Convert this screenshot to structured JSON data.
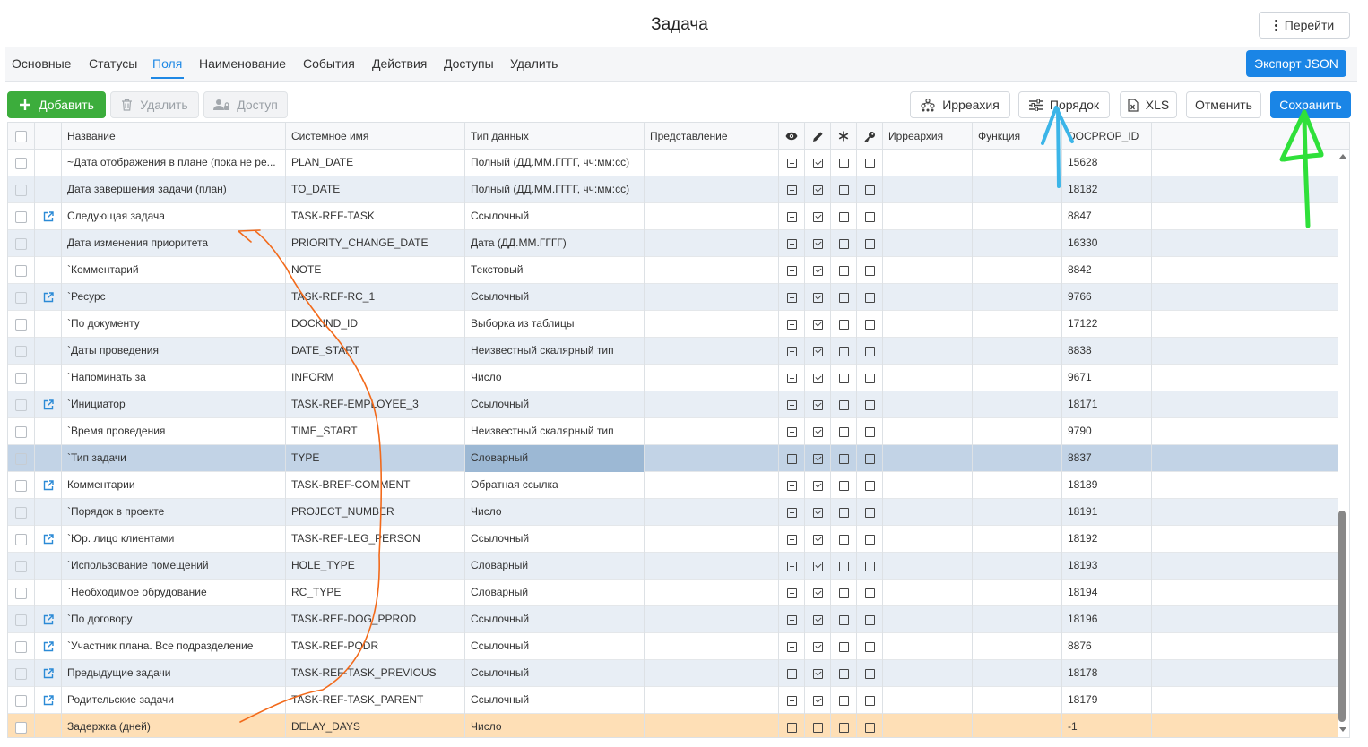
{
  "header": {
    "title": "Задача",
    "goto_label": "Перейти"
  },
  "tabs": [
    {
      "label": "Основные",
      "active": false
    },
    {
      "label": "Статусы",
      "active": false
    },
    {
      "label": "Поля",
      "active": true
    },
    {
      "label": "Наименование",
      "active": false
    },
    {
      "label": "События",
      "active": false
    },
    {
      "label": "Действия",
      "active": false
    },
    {
      "label": "Доступы",
      "active": false
    },
    {
      "label": "Удалить",
      "active": false
    }
  ],
  "export_label": "Экспорт JSON",
  "toolbar": {
    "add_label": "Добавить",
    "delete_label": "Удалить",
    "access_label": "Доступ",
    "hierarchy_label": "Ирреахия",
    "order_label": "Порядок",
    "xls_label": "XLS",
    "cancel_label": "Отменить",
    "save_label": "Сохранить"
  },
  "columns": {
    "name": "Название",
    "sysname": "Системное имя",
    "datatype": "Тип данных",
    "view": "Представление",
    "hierarchy": "Иррearхия",
    "function": "Функция",
    "docprop": "DOCPROP_ID"
  },
  "rows": [
    {
      "link": false,
      "name": "~Дата отображения в плане (пока не ре...",
      "sys": "PLAN_DATE",
      "type": "Полный (ДД.ММ.ГГГГ, чч:мм:сс)",
      "id": "15628",
      "flags": [
        "minus",
        "check",
        "empty",
        "empty"
      ]
    },
    {
      "link": false,
      "name": "Дата завершения задачи (план)",
      "sys": "TO_DATE",
      "type": "Полный (ДД.ММ.ГГГГ, чч:мм:сс)",
      "id": "18182",
      "flags": [
        "minus",
        "check",
        "empty",
        "empty"
      ]
    },
    {
      "link": true,
      "name": "Следующая задача",
      "sys": "TASK-REF-TASK",
      "type": "Ссылочный",
      "id": "8847",
      "flags": [
        "minus",
        "check",
        "empty",
        "empty"
      ]
    },
    {
      "link": false,
      "name": "Дата изменения приоритета",
      "sys": "PRIORITY_CHANGE_DATE",
      "type": "Дата (ДД.ММ.ГГГГ)",
      "id": "16330",
      "flags": [
        "minus",
        "check",
        "empty",
        "empty"
      ]
    },
    {
      "link": false,
      "name": "`Комментарий",
      "sys": "NOTE",
      "type": "Текстовый",
      "id": "8842",
      "flags": [
        "minus",
        "check",
        "empty",
        "empty"
      ]
    },
    {
      "link": true,
      "name": "`Ресурс",
      "sys": "TASK-REF-RC_1",
      "type": "Ссылочный",
      "id": "9766",
      "flags": [
        "minus",
        "check",
        "empty",
        "empty"
      ]
    },
    {
      "link": false,
      "name": "`По документу",
      "sys": "DOCKIND_ID",
      "type": "Выборка из таблицы",
      "id": "17122",
      "flags": [
        "minus",
        "check",
        "empty",
        "empty"
      ]
    },
    {
      "link": false,
      "name": "`Даты проведения",
      "sys": "DATE_START",
      "type": "Неизвестный скалярный тип",
      "id": "8838",
      "flags": [
        "minus",
        "check",
        "empty",
        "empty"
      ]
    },
    {
      "link": false,
      "name": "`Напоминать за",
      "sys": "INFORM",
      "type": "Число",
      "id": "9671",
      "flags": [
        "minus",
        "check",
        "empty",
        "empty"
      ]
    },
    {
      "link": true,
      "name": "`Инициатор",
      "sys": "TASK-REF-EMPLOYEE_3",
      "type": "Ссылочный",
      "id": "18171",
      "flags": [
        "minus",
        "check",
        "empty",
        "empty"
      ]
    },
    {
      "link": false,
      "name": "`Время проведения",
      "sys": "TIME_START",
      "type": "Неизвестный скалярный тип",
      "id": "9790",
      "flags": [
        "minus",
        "check",
        "empty",
        "empty"
      ]
    },
    {
      "link": false,
      "name": "`Тип задачи",
      "sys": "TYPE",
      "type": "Словарный",
      "id": "8837",
      "flags": [
        "minus",
        "check",
        "empty",
        "empty"
      ]
    },
    {
      "link": true,
      "name": "Комментарии",
      "sys": "TASK-BREF-COMMENT",
      "type": "Обратная ссылка",
      "id": "18189",
      "flags": [
        "minus",
        "check",
        "empty",
        "empty"
      ]
    },
    {
      "link": false,
      "name": "`Порядок в проекте",
      "sys": "PROJECT_NUMBER",
      "type": "Число",
      "id": "18191",
      "flags": [
        "minus",
        "check",
        "empty",
        "empty"
      ]
    },
    {
      "link": true,
      "name": "`Юр. лицо клиентами",
      "sys": "TASK-REF-LEG_PERSON",
      "type": "Ссылочный",
      "id": "18192",
      "flags": [
        "minus",
        "check",
        "empty",
        "empty"
      ]
    },
    {
      "link": false,
      "name": "`Использование помещений",
      "sys": "HOLE_TYPE",
      "type": "Словарный",
      "id": "18193",
      "flags": [
        "minus",
        "check",
        "empty",
        "empty"
      ]
    },
    {
      "link": false,
      "name": "`Необходимое обрудование",
      "sys": "RC_TYPE",
      "type": "Словарный",
      "id": "18194",
      "flags": [
        "minus",
        "check",
        "empty",
        "empty"
      ]
    },
    {
      "link": true,
      "name": "`По договору",
      "sys": "TASK-REF-DOG_PPROD",
      "type": "Ссылочный",
      "id": "18196",
      "flags": [
        "minus",
        "check",
        "empty",
        "empty"
      ]
    },
    {
      "link": true,
      "name": "`Участник плана. Все подразделение",
      "sys": "TASK-REF-PODR",
      "type": "Ссылочный",
      "id": "8876",
      "flags": [
        "minus",
        "check",
        "empty",
        "empty"
      ]
    },
    {
      "link": true,
      "name": "Предыдущие задачи",
      "sys": "TASK-REF-TASK_PREVIOUS",
      "type": "Ссылочный",
      "id": "18178",
      "flags": [
        "minus",
        "check",
        "empty",
        "empty"
      ]
    },
    {
      "link": true,
      "name": "Родительские задачи",
      "sys": "TASK-REF-TASK_PARENT",
      "type": "Ссылочный",
      "id": "18179",
      "flags": [
        "minus",
        "check",
        "empty",
        "empty"
      ]
    },
    {
      "link": false,
      "name": "Задержка (дней)",
      "sys": "DELAY_DAYS",
      "type": "Число",
      "id": "-1",
      "flags": [
        "empty",
        "empty",
        "empty",
        "empty"
      ]
    }
  ],
  "selected_row": 11,
  "new_row": 21,
  "colors": {
    "accent": "#1a85e6",
    "add_green": "#3cad3c",
    "row_alt": "#e8eef5",
    "row_selected": "#c2d3e6",
    "row_new": "#fedfb6",
    "annotation_orange": "#f26a1b",
    "annotation_blue": "#3bb5e8",
    "annotation_green": "#2fe03a"
  },
  "icons": {
    "column_view": "eye-icon",
    "column_edit": "pencil-icon",
    "column_required": "asterisk-icon",
    "column_key": "key-icon",
    "row_link": "external-link-icon"
  }
}
